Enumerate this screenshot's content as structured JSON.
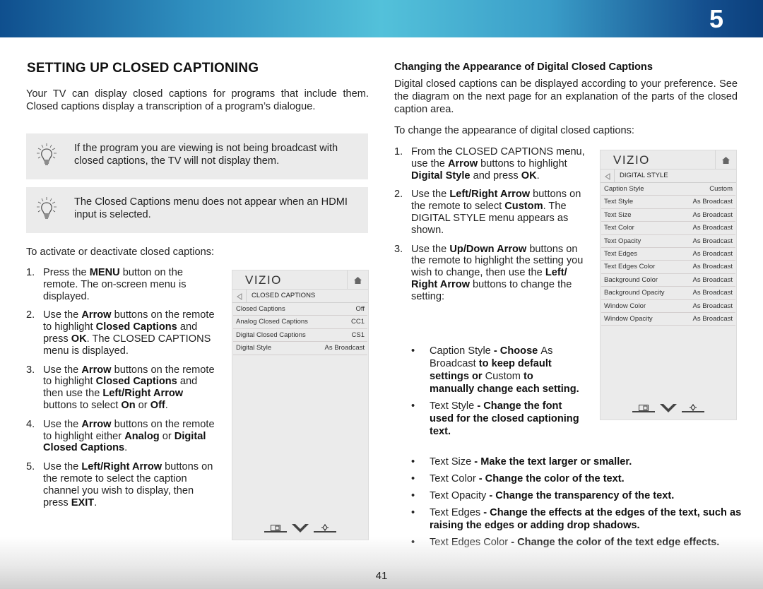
{
  "header": {
    "chapter_number": "5"
  },
  "footer": {
    "page_number": "41"
  },
  "left": {
    "title": "SETTING UP CLOSED CAPTIONING",
    "intro": "Your TV can display closed captions for programs that include them. Closed captions display a transcription of a program’s dialogue.",
    "tips": [
      {
        "icon": "lightbulb-icon",
        "text": "If the program you are viewing is not being broadcast with closed captions, the TV will not display them."
      },
      {
        "icon": "lightbulb-icon",
        "text": "The Closed Captions menu does not appear when an HDMI input is selected."
      }
    ],
    "steps_intro": "To activate or deactivate closed captions:",
    "steps": [
      {
        "num": "1.",
        "parts": [
          "Press the ",
          "MENU",
          " button on the remote. The on-screen menu is displayed."
        ]
      },
      {
        "num": "2.",
        "parts": [
          "Use the ",
          "Arrow",
          " buttons on the remote to highlight ",
          "Closed Captions",
          " and press ",
          "OK",
          ". The CLOSED CAPTIONS menu is displayed."
        ]
      },
      {
        "num": "3.",
        "parts": [
          "Use the ",
          "Arrow",
          " buttons on the remote to highlight ",
          "Closed Captions",
          " and then use the ",
          "Left/Right Arrow",
          " buttons to select ",
          "On",
          " or ",
          "Off",
          "."
        ]
      },
      {
        "num": "4.",
        "parts": [
          "Use the ",
          "Arrow",
          " buttons on the remote to highlight either ",
          "Analog",
          " or ",
          "Digital Closed Captions",
          "."
        ]
      },
      {
        "num": "5.",
        "parts": [
          "Use the ",
          "Left/Right Arrow",
          " buttons on the remote to select the caption channel you wish to display, then press ",
          "EXIT",
          "."
        ]
      }
    ],
    "menu": {
      "logo": "VIZIO",
      "breadcrumb": "CLOSED CAPTIONS",
      "rows": [
        {
          "label": "Closed Captions",
          "value": "Off"
        },
        {
          "label": "Analog Closed Captions",
          "value": "CC1"
        },
        {
          "label": "Digital Closed Captions",
          "value": "CS1"
        },
        {
          "label": "Digital Style",
          "value": "As Broadcast"
        }
      ]
    }
  },
  "right": {
    "subtitle": "Changing the Appearance of Digital Closed Captions",
    "intro": "Digital closed captions can be displayed according to your preference. See the diagram on the next page for an explanation of the parts of the closed caption area.",
    "steps_intro": "To change the appearance of digital closed captions:",
    "steps": [
      {
        "num": "1.",
        "parts": [
          "From the CLOSED CAPTIONS menu, use the ",
          "Arrow",
          " buttons to highlight ",
          "Digital Style",
          " and press ",
          "OK",
          "."
        ]
      },
      {
        "num": "2.",
        "parts": [
          "Use the ",
          "Left/Right Arrow",
          " buttons on the remote to select ",
          "Custom",
          ". The DIGITAL STYLE menu appears as shown."
        ]
      },
      {
        "num": "3.",
        "parts": [
          "Use the ",
          "Up/Down Arrow",
          " buttons on the remote to highlight the setting you wish to change, then use the ",
          "Left/ Right Arrow",
          " buttons to change the setting:"
        ]
      }
    ],
    "bullets_narrow": [
      {
        "parts": [
          "Caption Style",
          " - Choose ",
          "As Broadcast",
          " to keep default settings or ",
          "Custom",
          " to manually change each setting."
        ]
      },
      {
        "parts": [
          "Text Style",
          "  - Change the font used for the closed captioning text."
        ]
      }
    ],
    "bullets_wide": [
      {
        "parts": [
          "Text Size",
          " - Make the text larger or smaller."
        ]
      },
      {
        "parts": [
          "Text Color",
          " - Change the color of the text."
        ]
      },
      {
        "parts": [
          "Text Opacity",
          " - Change the transparency of the text."
        ]
      },
      {
        "parts": [
          "Text Edges",
          " - Change the effects at the edges of the text, such as raising the edges or adding drop shadows."
        ]
      },
      {
        "parts": [
          "Text Edges Color",
          " - Change the color of the text edge effects."
        ]
      }
    ],
    "menu": {
      "logo": "VIZIO",
      "breadcrumb": "DIGITAL STYLE",
      "rows": [
        {
          "label": "Caption Style",
          "value": "Custom"
        },
        {
          "label": "Text Style",
          "value": "As Broadcast"
        },
        {
          "label": "Text Size",
          "value": "As Broadcast"
        },
        {
          "label": "Text Color",
          "value": "As Broadcast"
        },
        {
          "label": "Text Opacity",
          "value": "As Broadcast"
        },
        {
          "label": "Text Edges",
          "value": "As Broadcast"
        },
        {
          "label": "Text Edges Color",
          "value": "As Broadcast"
        },
        {
          "label": "Background Color",
          "value": "As Broadcast"
        },
        {
          "label": "Background Opacity",
          "value": "As Broadcast"
        },
        {
          "label": "Window Color",
          "value": "As Broadcast"
        },
        {
          "label": "Window Opacity",
          "value": "As Broadcast"
        }
      ]
    }
  },
  "colors": {
    "banner_light": "#53c1da",
    "banner_dark": "#0b3f7c",
    "tip_bg": "#ebebeb",
    "menu_bg": "#ebebeb"
  }
}
